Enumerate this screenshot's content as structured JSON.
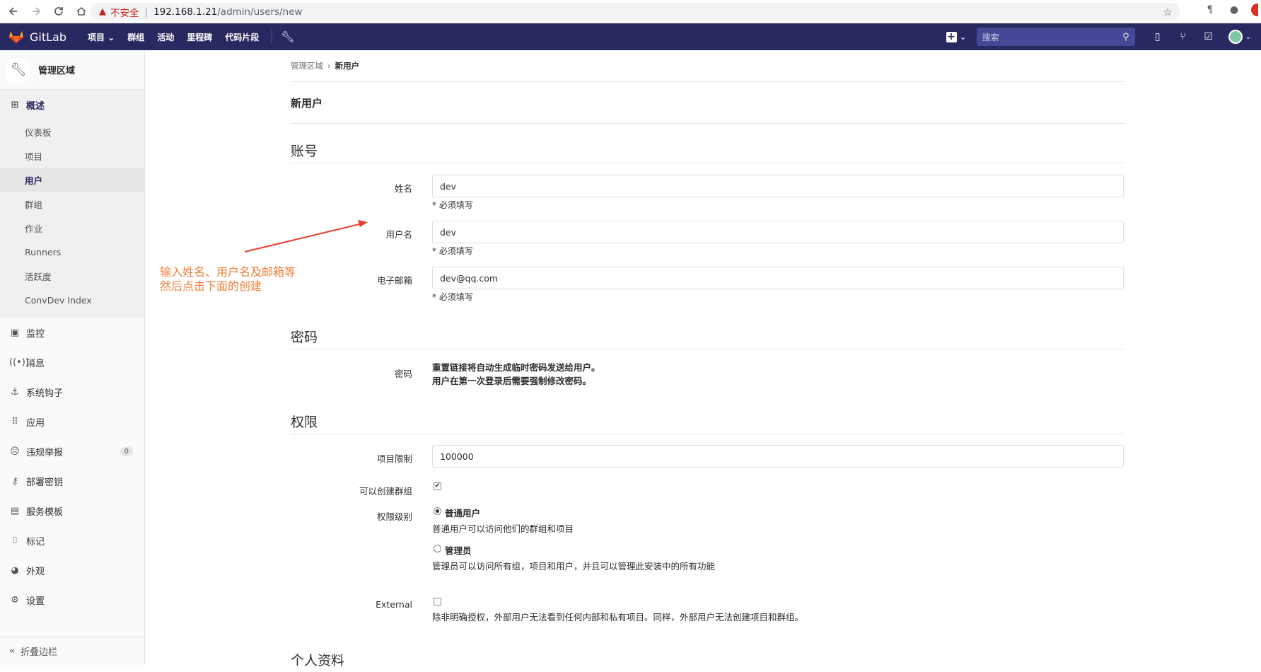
{
  "browser": {
    "insecure_label": "不安全",
    "url_host": "192.168.1.21",
    "url_path": "/admin/users/new"
  },
  "header": {
    "logo_text": "GitLab",
    "nav": [
      "项目",
      "群组",
      "活动",
      "里程碑",
      "代码片段"
    ],
    "search_placeholder": "搜索"
  },
  "sidebar": {
    "title": "管理区域",
    "overview_label": "概述",
    "sub_items": [
      "仪表板",
      "项目",
      "用户",
      "群组",
      "作业",
      "Runners",
      "活跃度",
      "ConvDev Index"
    ],
    "items": [
      "监控",
      "消息",
      "系统钩子",
      "应用",
      "违规举报",
      "部署密钥",
      "服务模板",
      "标记",
      "外观",
      "设置"
    ],
    "abuse_badge": "0",
    "collapse_label": "折叠边栏"
  },
  "breadcrumb": {
    "parent": "管理区域",
    "current": "新用户"
  },
  "page_title": "新用户",
  "account": {
    "title": "账号",
    "name_label": "姓名",
    "name_value": "dev",
    "required_hint": "* 必须填写",
    "username_label": "用户名",
    "username_value": "dev",
    "email_label": "电子邮箱",
    "email_value": "dev@qq.com"
  },
  "password": {
    "title": "密码",
    "label": "密码",
    "line1": "重置链接将自动生成临时密码发送给用户。",
    "line2": "用户在第一次登录后需要强制修改密码。"
  },
  "access": {
    "title": "权限",
    "project_limit_label": "项目限制",
    "project_limit_value": "100000",
    "can_create_group_label": "可以创建群组",
    "access_level_label": "权限级别",
    "regular_label": "普通用户",
    "regular_desc": "普通用户可以访问他们的群组和项目",
    "admin_label": "管理员",
    "admin_desc": "管理员可以访问所有组，项目和用户，并且可以管理此安装中的所有功能",
    "external_label": "External",
    "external_desc": "除非明确授权，外部用户无法看到任何内部和私有项目。同样，外部用户无法创建项目和群组。"
  },
  "profile": {
    "title": "个人资料"
  },
  "annotation": {
    "line1": "输入姓名、用户名及邮箱等",
    "line2": "然后点击下面的创建",
    "color": "#ee7f3a"
  }
}
